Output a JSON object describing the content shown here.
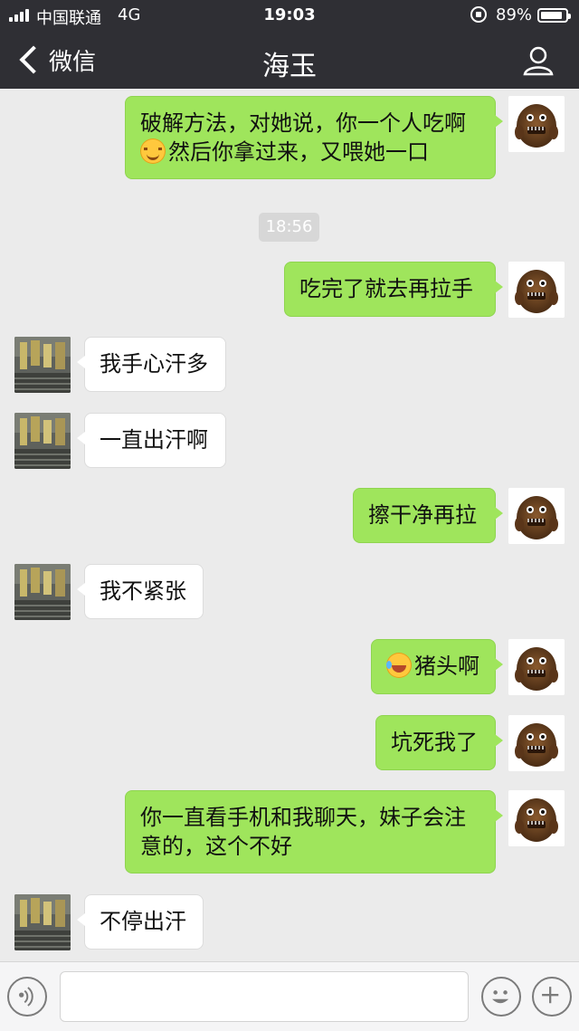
{
  "status_bar": {
    "carrier": "中国联通",
    "network": "4G",
    "time": "19:03",
    "battery": "89%",
    "battery_level": 0.89
  },
  "nav": {
    "back_label": "微信",
    "title": "海玉"
  },
  "messages": [
    {
      "side": "me",
      "line1": "破解方法，对她说，你一个人吃啊",
      "line2": "然后你拿过来，又喂她一口",
      "emoji": "blushing-smile-emoji"
    },
    {
      "side": "me",
      "text": "吃完了就去再拉手"
    },
    {
      "side": "them",
      "text": "我手心汗多"
    },
    {
      "side": "them",
      "text": "一直出汗啊"
    },
    {
      "side": "me",
      "text": "擦干净再拉"
    },
    {
      "side": "them",
      "text": "我不紧张"
    },
    {
      "side": "me",
      "text": "猪头啊",
      "emoji": "laughing-tears-emoji"
    },
    {
      "side": "me",
      "text": "坑死我了"
    },
    {
      "side": "me",
      "line1": "你一直看手机和我聊天，妹子会注",
      "line2": "意的，这个不好"
    },
    {
      "side": "them",
      "text": "不停出汗"
    }
  ],
  "timestamp": "18:56",
  "input": {
    "value": ""
  }
}
